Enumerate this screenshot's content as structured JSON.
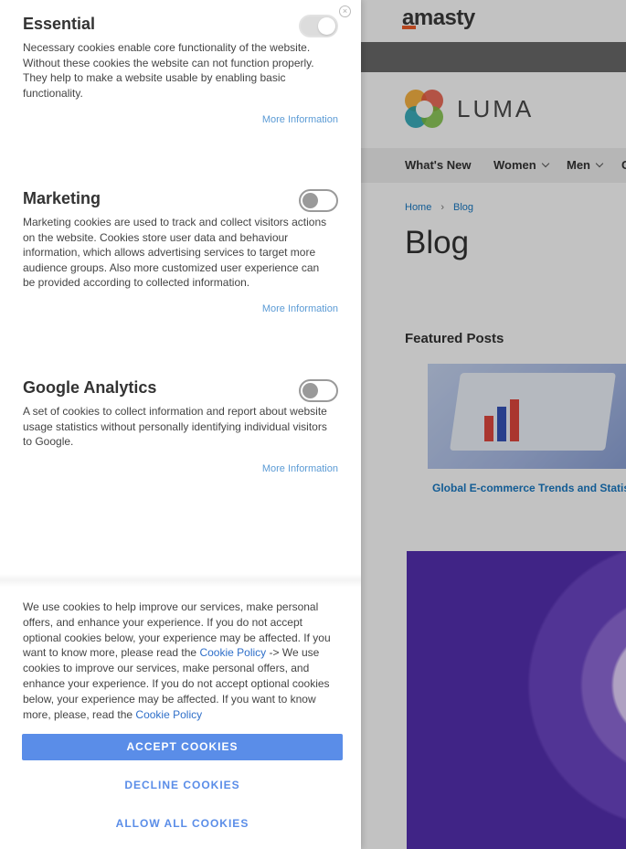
{
  "background": {
    "brand": "amasty",
    "store_name": "LUMA",
    "nav": [
      {
        "label": "What's New",
        "has_chevron": false
      },
      {
        "label": "Women",
        "has_chevron": true
      },
      {
        "label": "Men",
        "has_chevron": true
      },
      {
        "label": "G",
        "has_chevron": false
      }
    ],
    "breadcrumb": {
      "home": "Home",
      "separator": "›",
      "current": "Blog"
    },
    "page_title": "Blog",
    "featured_title": "Featured Posts",
    "post_title": "Global E-commerce Trends and Statis"
  },
  "cookie_panel": {
    "close_icon": "×",
    "sections": [
      {
        "title": "Essential",
        "description": "Necessary cookies enable core functionality of the website. Without these cookies the website can not function properly. They help to make a website usable by enabling basic functionality.",
        "more_info": "More Information",
        "toggle_state": "on-disabled"
      },
      {
        "title": "Marketing",
        "description": "Marketing cookies are used to track and collect visitors actions on the website. Cookies store user data and behaviour information, which allows advertising services to target more audience groups. Also more customized user experience can be provided according to collected information.",
        "more_info": "More Information",
        "toggle_state": "off"
      },
      {
        "title": "Google Analytics",
        "description": "A set of cookies to collect information and report about website usage statistics without personally identifying individual visitors to Google.",
        "more_info": "More Information",
        "toggle_state": "off"
      }
    ],
    "policy": {
      "part1": "We use cookies to help improve our services, make personal offers, and enhance your experience. If you do not accept optional cookies below, your experience may be affected. If you want to know more, please read the ",
      "link1": "Cookie Policy",
      "part2": " -> We use cookies to improve our services, make personal offers, and enhance your experience. If you do not accept optional cookies below, your experience may be affected. If you want to know more, please, read the ",
      "link2": "Cookie Policy"
    },
    "accept_label": "ACCEPT COOKIES",
    "decline_label": "DECLINE COOKIES",
    "allow_all_label": "ALLOW ALL COOKIES"
  },
  "colors": {
    "accent": "#5a8de8",
    "link": "#2f6fc9"
  }
}
